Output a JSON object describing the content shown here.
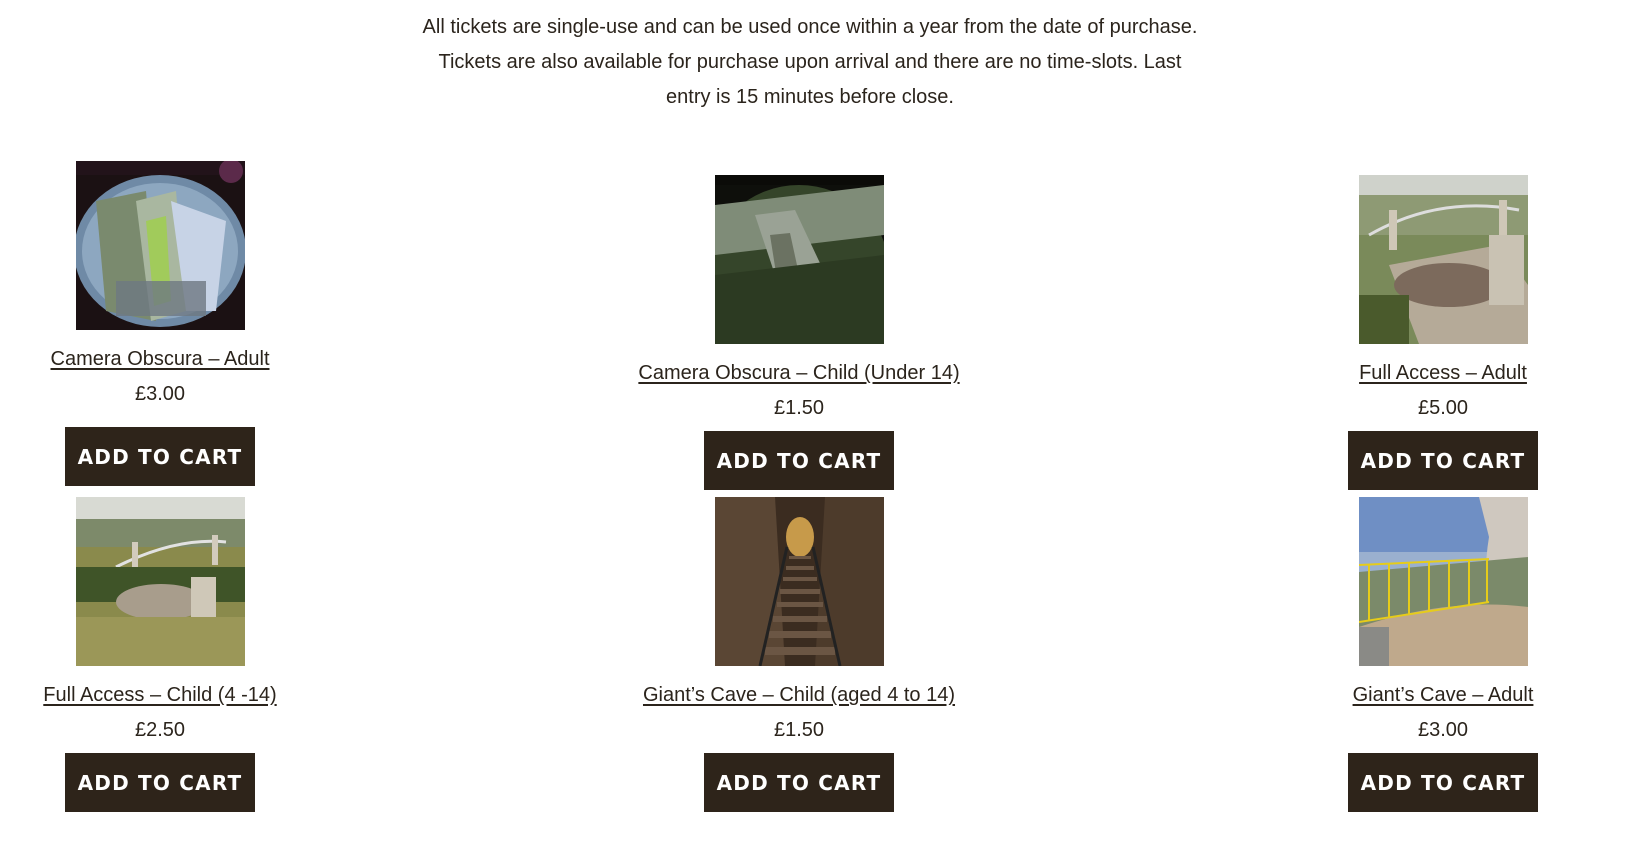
{
  "intro_text": "All tickets are single-use and can be used once within a year from the date of purchase. Tickets are also available for purchase upon arrival and there are no time-slots. Last entry is 15 minutes before close.",
  "add_to_cart_label": "ADD TO CART",
  "products": [
    {
      "title": "Camera Obscura – Adult",
      "price": "£3.00",
      "image": "camera-obscura-table-photo"
    },
    {
      "title": "Camera Obscura – Child (Under 14)",
      "price": "£1.50",
      "image": "camera-obscura-bridge-view-photo"
    },
    {
      "title": "Full Access – Adult",
      "price": "£5.00",
      "image": "observatory-bridge-aerial-photo"
    },
    {
      "title": "Full Access – Child (4 -14)",
      "price": "£2.50",
      "image": "observatory-lawn-aerial-photo"
    },
    {
      "title": "Giant’s Cave – Child (aged 4 to 14)",
      "price": "£1.50",
      "image": "cave-staircase-photo"
    },
    {
      "title": "Giant’s Cave – Adult",
      "price": "£3.00",
      "image": "cave-balcony-photo"
    }
  ],
  "colors": {
    "button_bg": "#2e241a",
    "button_text": "#ffffff",
    "text": "#2b241c"
  }
}
